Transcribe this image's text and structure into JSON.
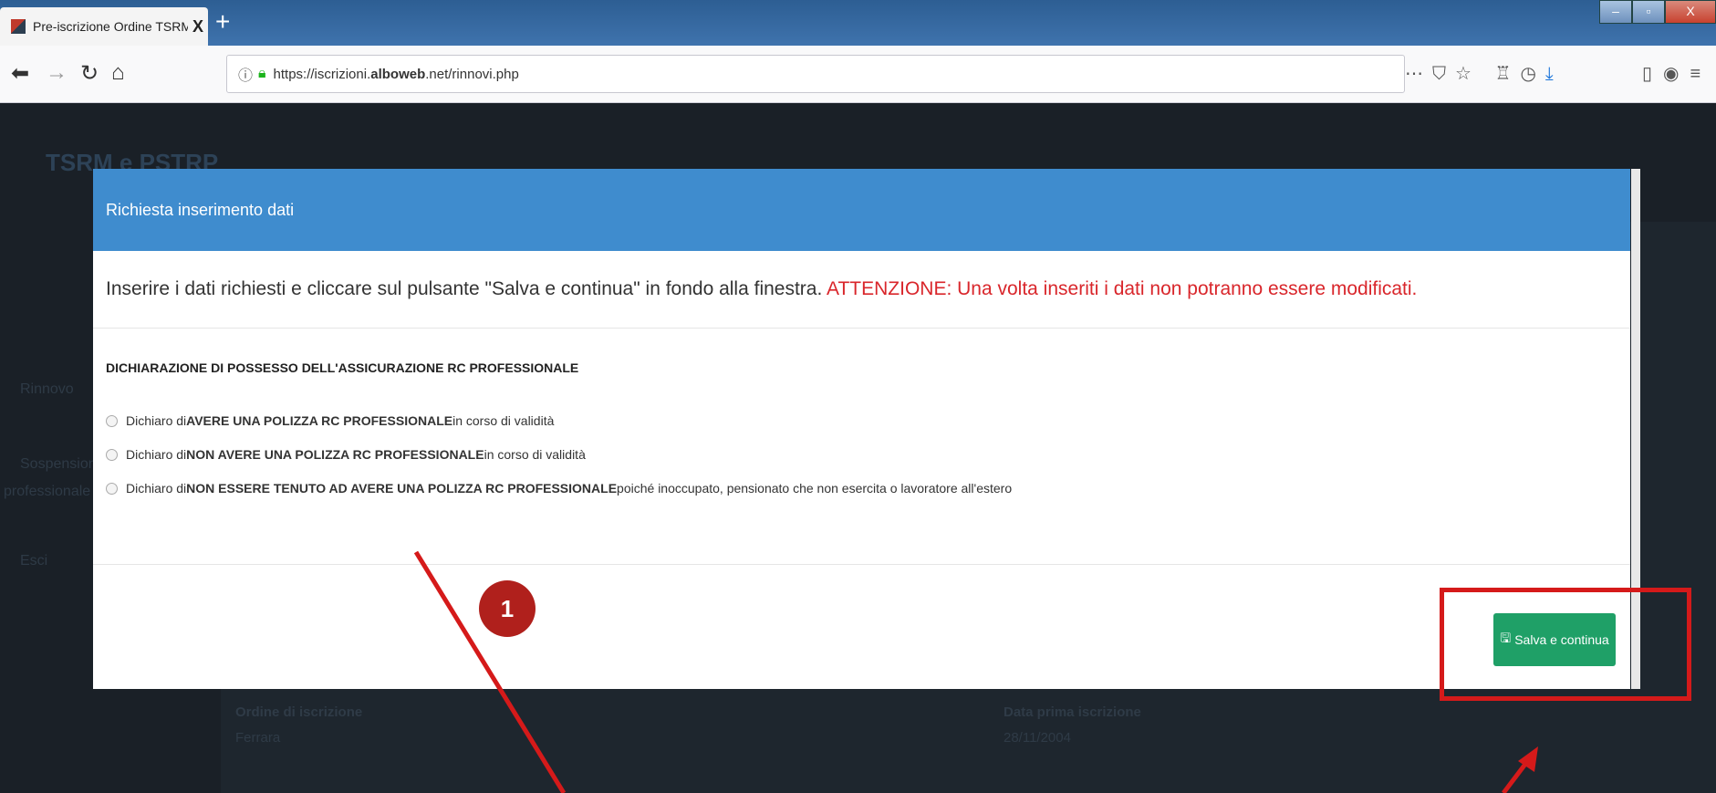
{
  "browser": {
    "tab_title": "Pre-iscrizione Ordine TSRM e P",
    "tab_close": "X",
    "new_tab": "+",
    "url_host_prefix": "https://iscrizioni.",
    "url_host_bold": "alboweb",
    "url_rest": ".net/rinnovi.php",
    "window_controls": [
      "–",
      "▫",
      "X"
    ]
  },
  "background": {
    "brand": "TSRM e PSTRP",
    "sidebar_items": [
      "Rinnovo",
      "Sospensione",
      "professionale",
      "Esci"
    ],
    "fields": [
      {
        "label": "Ordine di iscrizione",
        "value": "Ferrara"
      },
      {
        "label": "Data prima iscrizione",
        "value": "28/11/2004"
      }
    ]
  },
  "modal": {
    "title": "Richiesta inserimento dati",
    "intro": "Inserire i dati richiesti e cliccare sul pulsante \"Salva e continua\" in fondo alla finestra.",
    "warning": "ATTENZIONE: Una volta inseriti i dati non potranno essere modificati.",
    "section_title": "DICHIARAZIONE DI POSSESSO DELL'ASSICURAZIONE RC PROFESSIONALE",
    "options": [
      {
        "pre": "Dichiaro di ",
        "bold": "AVERE UNA POLIZZA RC PROFESSIONALE",
        "post": " in corso di validità"
      },
      {
        "pre": "Dichiaro di ",
        "bold": "NON AVERE UNA POLIZZA RC PROFESSIONALE",
        "post": " in corso di validità"
      },
      {
        "pre": "Dichiaro di ",
        "bold": "NON ESSERE TENUTO AD AVERE UNA POLIZZA RC PROFESSIONALE",
        "post": " poiché inoccupato, pensionato che non esercita o lavoratore all'estero"
      }
    ],
    "save_label": "Salva e continua"
  },
  "annotation": {
    "badge": "1",
    "color": "#d51a1a"
  }
}
